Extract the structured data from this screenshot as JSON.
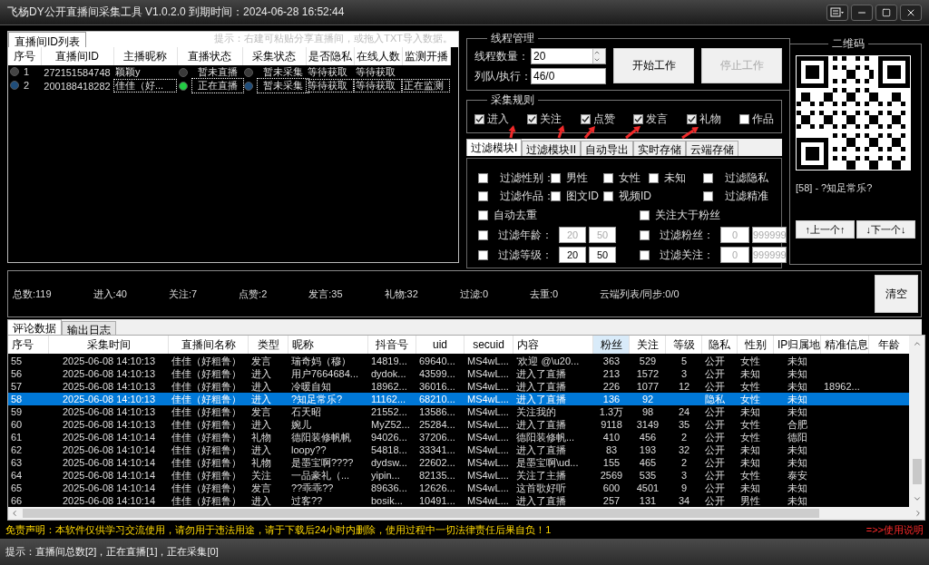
{
  "window": {
    "title": "飞杨DY公开直播间采集工具 V1.0.2.0 到期时间：2024-06-28 16:52:44"
  },
  "room_list": {
    "tab": "直播间ID列表",
    "hint": "提示：右建可粘贴分享直播间，或拖入TXT导入数据。",
    "columns": [
      "序号",
      "直播间ID",
      "主播昵称",
      "直播状态",
      "采集状态",
      "是否隐私",
      "在线人数",
      "监测开播"
    ],
    "rows": [
      {
        "index": "1",
        "room_id": "272151584748",
        "nickname": "颖颖y",
        "live": false,
        "live_status": "暂未直播",
        "collecting": false,
        "collect_status": "暂未采集",
        "private": "等待获取",
        "online": "等待获取",
        "selected": false
      },
      {
        "index": "2",
        "room_id": "200188418282",
        "nickname": "佳佳（好...",
        "live": true,
        "live_status": "正在直播",
        "collecting": false,
        "collect_status": "暂未采集",
        "private": "等待获取",
        "online": "等待获取",
        "monitor": "正在监测",
        "selected": true
      }
    ]
  },
  "thread": {
    "title": "线程管理",
    "count_label": "线程数量：",
    "count": "20",
    "queue_label": "列队/执行：",
    "queue": "46/0",
    "buttons": [
      {
        "label": "开始工作",
        "disabled": false
      },
      {
        "label": "停止工作",
        "disabled": true
      }
    ]
  },
  "rules": {
    "title": "采集规则",
    "items": [
      {
        "label": "进入",
        "checked": true
      },
      {
        "label": "关注",
        "checked": true
      },
      {
        "label": "点赞",
        "checked": true
      },
      {
        "label": "发言",
        "checked": true
      },
      {
        "label": "礼物",
        "checked": true
      },
      {
        "label": "作品",
        "checked": false
      }
    ]
  },
  "filter_tabs": [
    {
      "label": "过滤模块I",
      "selected": true
    },
    {
      "label": "过滤模块II",
      "selected": false
    },
    {
      "label": "自动导出",
      "selected": false
    },
    {
      "label": "实时存储",
      "selected": false
    },
    {
      "label": "云端存储",
      "selected": false
    }
  ],
  "filter_rows": [
    {
      "kind": "checks",
      "items": [
        {
          "label": "过滤性别：",
          "checked": false
        },
        {
          "label": "男性",
          "checked": false
        },
        {
          "label": "女性",
          "checked": false
        },
        {
          "label": "未知",
          "checked": false
        },
        {
          "label": "过滤隐私",
          "checked": false
        }
      ]
    },
    {
      "kind": "checks",
      "items": [
        {
          "label": "过滤作品：",
          "checked": false
        },
        {
          "label": "图文ID",
          "checked": false
        },
        {
          "label": "视频ID",
          "checked": false
        },
        {
          "label": "过滤精准",
          "checked": false
        }
      ]
    },
    {
      "kind": "pair",
      "items": [
        {
          "kind": "check",
          "label": "自动去重",
          "checked": false
        },
        {
          "kind": "check",
          "label": "关注大于粉丝",
          "checked": false
        }
      ]
    },
    {
      "kind": "pair",
      "items": [
        {
          "kind": "range",
          "label": "过滤年龄：",
          "checked": false,
          "min": "20",
          "max": "50",
          "disabled": true
        },
        {
          "kind": "range",
          "label": "过滤粉丝：",
          "checked": false,
          "min": "0",
          "max": "999999",
          "disabled": true
        }
      ]
    },
    {
      "kind": "pair",
      "items": [
        {
          "kind": "range",
          "label": "过滤等级：",
          "checked": false,
          "min": "20",
          "max": "50",
          "disabled": false
        },
        {
          "kind": "range",
          "label": "过滤关注：",
          "checked": false,
          "min": "0",
          "max": "999999",
          "disabled": true
        }
      ]
    }
  ],
  "qr": {
    "title": "二维码",
    "caption": "[58] - ?知足常乐?",
    "buttons": [
      "↑上一个↑",
      "↓下一个↓"
    ]
  },
  "stats": {
    "items": [
      "总数:119",
      "进入:40",
      "关注:7",
      "点赞:2",
      "发言:35",
      "礼物:32",
      "过滤:0",
      "去重:0",
      "云端列表/同步:0/0"
    ],
    "clear_button": "清空"
  },
  "data_tabs": [
    {
      "label": "评论数据",
      "selected": true
    },
    {
      "label": "输出日志",
      "selected": false
    }
  ],
  "data_table": {
    "columns": [
      {
        "label": "序号",
        "sorted": false
      },
      {
        "label": "采集时间",
        "sorted": false
      },
      {
        "label": "直播间名称",
        "sorted": false
      },
      {
        "label": "类型",
        "sorted": false
      },
      {
        "label": "昵称",
        "sorted": false
      },
      {
        "label": "抖音号",
        "sorted": false
      },
      {
        "label": "uid",
        "sorted": false
      },
      {
        "label": "secuid",
        "sorted": false
      },
      {
        "label": "内容",
        "sorted": false
      },
      {
        "label": "粉丝",
        "sorted": true
      },
      {
        "label": "关注",
        "sorted": false
      },
      {
        "label": "等级",
        "sorted": false
      },
      {
        "label": "隐私",
        "sorted": false
      },
      {
        "label": "性别",
        "sorted": false
      },
      {
        "label": "IP归属地",
        "sorted": false
      },
      {
        "label": "精准信息",
        "sorted": false
      },
      {
        "label": "年龄",
        "sorted": false
      }
    ],
    "rows": [
      {
        "selected": false,
        "cells": [
          "55",
          "2025-06-08 14:10:13",
          "佳佳（好粗鲁）",
          "发言",
          "瑞奇妈（穆）",
          "14819...",
          "69640...",
          "MS4wL...",
          "‘欢迎 @\\u20...",
          "363",
          "529",
          "5",
          "公开",
          "女性",
          "未知"
        ]
      },
      {
        "selected": false,
        "cells": [
          "56",
          "2025-06-08 14:10:13",
          "佳佳（好粗鲁）",
          "进入",
          "用户7664684...",
          "dydok...",
          "43599...",
          "MS4wL...",
          "进入了直播",
          "213",
          "1572",
          "3",
          "公开",
          "未知",
          "未知"
        ]
      },
      {
        "selected": false,
        "cells": [
          "57",
          "2025-06-08 14:10:13",
          "佳佳（好粗鲁）",
          "进入",
          "冷暖自知",
          "18962...",
          "36016...",
          "MS4wL...",
          "进入了直播",
          "226",
          "1077",
          "12",
          "公开",
          "女性",
          "未知",
          "18962..."
        ]
      },
      {
        "selected": true,
        "cells": [
          "58",
          "2025-06-08 14:10:13",
          "佳佳（好粗鲁）",
          "进入",
          "?知足常乐?",
          "11162...",
          "68210...",
          "MS4wL...",
          "进入了直播",
          "136",
          "92",
          null,
          "隐私",
          "女性",
          "未知"
        ]
      },
      {
        "selected": false,
        "cells": [
          "59",
          "2025-06-08 14:10:13",
          "佳佳（好粗鲁）",
          "发言",
          "石天昭",
          "21552...",
          "13586...",
          "MS4wL...",
          "关注我的",
          "1.3万",
          "98",
          "24",
          "公开",
          "未知",
          "未知"
        ]
      },
      {
        "selected": false,
        "cells": [
          "60",
          "2025-06-08 14:10:13",
          "佳佳（好粗鲁）",
          "进入",
          "婉儿",
          "MyZ52...",
          "25284...",
          "MS4wL...",
          "进入了直播",
          "9118",
          "3149",
          "35",
          "公开",
          "女性",
          "合肥"
        ]
      },
      {
        "selected": false,
        "cells": [
          "61",
          "2025-06-08 14:10:14",
          "佳佳（好粗鲁）",
          "礼物",
          "德阳装修帆帆",
          "94026...",
          "37206...",
          "MS4wL...",
          "德阳装修帆...",
          "410",
          "456",
          "2",
          "公开",
          "女性",
          "德阳"
        ]
      },
      {
        "selected": false,
        "cells": [
          "62",
          "2025-06-08 14:10:14",
          "佳佳（好粗鲁）",
          "进入",
          "loopy??",
          "54818...",
          "33341...",
          "MS4wL...",
          "进入了直播",
          "83",
          "193",
          "32",
          "公开",
          "未知",
          "未知"
        ]
      },
      {
        "selected": false,
        "cells": [
          "63",
          "2025-06-08 14:10:14",
          "佳佳（好粗鲁）",
          "礼物",
          "是墨宝啊????",
          "dydsw...",
          "22602...",
          "MS4wL...",
          "是墨宝啊\\ud...",
          "155",
          "465",
          "2",
          "公开",
          "未知",
          "未知"
        ]
      },
      {
        "selected": false,
        "cells": [
          "64",
          "2025-06-08 14:10:14",
          "佳佳（好粗鲁）",
          "关注",
          "一品豪礼（...",
          "yipin...",
          "82135...",
          "MS4wL...",
          "关注了主播",
          "2569",
          "535",
          "3",
          "公开",
          "女性",
          "泰安"
        ]
      },
      {
        "selected": false,
        "cells": [
          "65",
          "2025-06-08 14:10:14",
          "佳佳（好粗鲁）",
          "发言",
          "??乖乖??",
          "89636...",
          "12626...",
          "MS4wL...",
          "这首歌好听",
          "600",
          "4501",
          "9",
          "公开",
          "未知",
          "未知"
        ]
      },
      {
        "selected": false,
        "cells": [
          "66",
          "2025-06-08 14:10:14",
          "佳佳（好粗鲁）",
          "进入",
          "过客??",
          "bosik...",
          "10491...",
          "MS4wL...",
          "进入了直播",
          "257",
          "131",
          "34",
          "公开",
          "男性",
          "未知"
        ]
      }
    ]
  },
  "disclaimer": {
    "text": "免责声明：本软件仅供学习交流使用，请勿用于违法用途，请于下载后24小时内删除，使用过程中一切法律责任后果自负！1",
    "link": "=>>使用说明"
  },
  "status_bar": "提示：直播间总数[2]，正在直播[1]，正在采集[0]"
}
